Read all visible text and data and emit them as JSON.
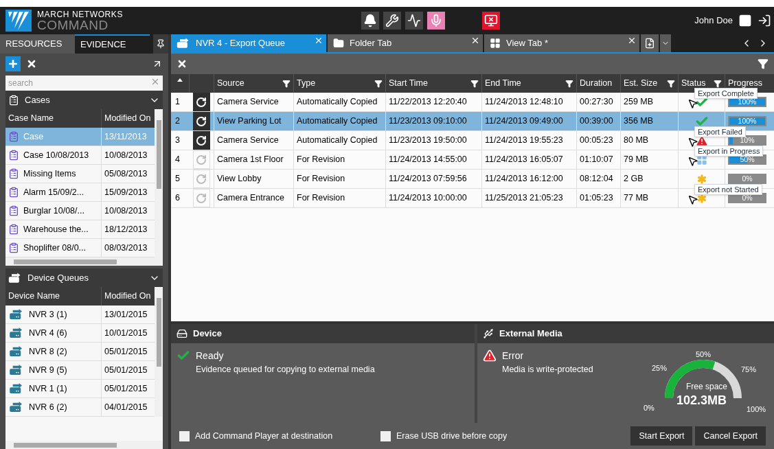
{
  "brand": {
    "line1": "MARCH NETWORKS",
    "line2": "COMMAND"
  },
  "user": {
    "name": "John Doe"
  },
  "left_tabs": [
    {
      "label": "RESOURCES",
      "selected": false
    },
    {
      "label": "EVIDENCE",
      "selected": true
    }
  ],
  "search": {
    "placeholder": "search"
  },
  "cases": {
    "title": "Cases",
    "columns": [
      "Case Name",
      "Modified On"
    ],
    "rows": [
      {
        "name": "Case",
        "modified": "13/11/2013",
        "selected": true
      },
      {
        "name": "Case 10/08/2013",
        "modified": "10/08/2013",
        "selected": false
      },
      {
        "name": "Missing Items",
        "modified": "05/08/2013",
        "selected": false
      },
      {
        "name": "Alarm 15/09/2...",
        "modified": "15/09/2013",
        "selected": false
      },
      {
        "name": "Burglar 10/08/...",
        "modified": "10/08/2013",
        "selected": false
      },
      {
        "name": "Warehouse the...",
        "modified": "18/12/2013",
        "selected": false
      },
      {
        "name": "Shoplifter 08/0...",
        "modified": "08/03/2013",
        "selected": false
      }
    ]
  },
  "device_queues": {
    "title": "Device Queues",
    "columns": [
      "Device Name",
      "Modified On"
    ],
    "rows": [
      {
        "name": "NVR 3 (1)",
        "modified": "13/01/2015"
      },
      {
        "name": "NVR 4 (6)",
        "modified": "10/01/2015"
      },
      {
        "name": "NVR 8 (2)",
        "modified": "05/01/2015"
      },
      {
        "name": "NVR 9 (5)",
        "modified": "05/01/2015"
      },
      {
        "name": "NVR 1 (1)",
        "modified": "05/01/2015"
      },
      {
        "name": "NVR 6 (2)",
        "modified": "04/01/2015"
      }
    ]
  },
  "tabs": [
    {
      "label": "NVR 4 - Export Queue",
      "kind": "queue",
      "selected": true
    },
    {
      "label": "Folder Tab",
      "kind": "folder",
      "selected": false
    },
    {
      "label": "View Tab *",
      "kind": "view",
      "selected": false
    }
  ],
  "table": {
    "columns": [
      "Source",
      "Type",
      "Start Time",
      "End Time",
      "Duration",
      "Est. Size",
      "Status",
      "Progress"
    ],
    "rows": [
      {
        "num": "1",
        "active": true,
        "source": "Camera Service",
        "type": "Automatically Copied",
        "start": "11/22/2013 12:20:40",
        "end": "11/24/2013 12:48:10",
        "duration": "00:27:30",
        "size": "259 MB",
        "kind": "complete",
        "level": 1,
        "progress": "100%",
        "selected": false,
        "tooltip": "Export Complete"
      },
      {
        "num": "2",
        "active": true,
        "source": "View Parking Lot",
        "type": "Automatically Copied",
        "start": "11/23/2013 09:10:00",
        "end": "11/24/2013 09:49:00",
        "duration": "00:39:00",
        "size": "356 MB",
        "kind": "complete",
        "level": 1,
        "progress": "100%",
        "selected": true
      },
      {
        "num": "3",
        "active": true,
        "source": "Camera Service",
        "type": "Automatically Copied",
        "start": "11/23/2013 19:50:00",
        "end": "11/24/2013 19:55:23",
        "duration": "00:05:23",
        "size": "80 MB",
        "kind": "failed",
        "level": 0.1,
        "progress": "10%",
        "selected": false,
        "tooltip": "Export Failed"
      },
      {
        "num": "4",
        "active": false,
        "source": "Camera 1st Floor",
        "type": "For Revision",
        "start": "11/24/2013 14:55:00",
        "end": "11/24/2013 16:05:07",
        "duration": "01:10:07",
        "size": "79 MB",
        "kind": "progress",
        "level": 0.5,
        "progress": "50%",
        "selected": false,
        "tooltip": "Export in Progress"
      },
      {
        "num": "5",
        "active": false,
        "source": "View Lobby",
        "type": "For Revision",
        "start": "11/24/2013 07:59:56",
        "end": "11/24/2013 16:12:00",
        "duration": "08:12:04",
        "size": "2 GB",
        "kind": "pending",
        "level": 0,
        "progress": "0%",
        "selected": false
      },
      {
        "num": "6",
        "active": false,
        "source": "Camera Entrance",
        "type": "For Revision",
        "start": "11/24/2013 10:00:00",
        "end": "11/25/2013 21:05:23",
        "duration": "01:05:23",
        "size": "77 MB",
        "kind": "pending",
        "level": 0,
        "progress": "0%",
        "selected": false,
        "tooltip": "Export not Started"
      }
    ]
  },
  "device": {
    "title": "Device",
    "state": "Ready",
    "message": "Evidence queued for copying to external media"
  },
  "external_media": {
    "title": "External Media",
    "state": "Error",
    "message": "Media is write-protected",
    "gauge": {
      "level": 0.6,
      "label": "Free space",
      "value": "102.3MB",
      "ticks": [
        "0%",
        "25%",
        "50%",
        "75%",
        "100%"
      ]
    }
  },
  "options": [
    {
      "label": "Add Command Player at destination",
      "checked": false
    },
    {
      "label": "Erase USB drive before copy",
      "checked": false
    }
  ],
  "buttons": [
    "Start Export",
    "Cancel Export"
  ]
}
